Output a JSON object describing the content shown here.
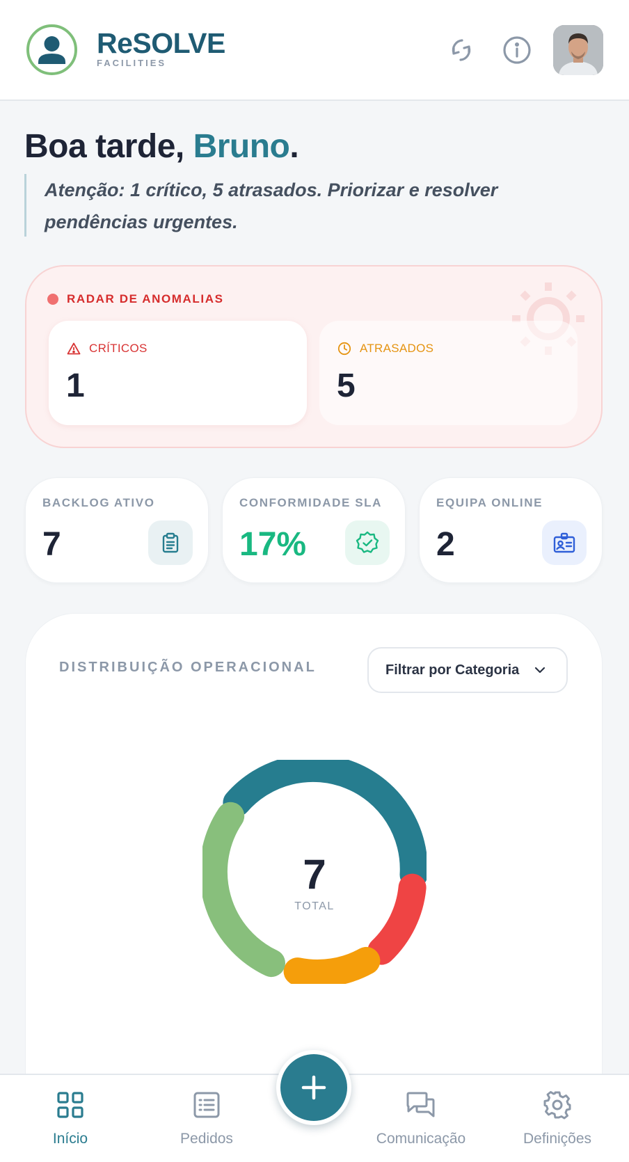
{
  "app": {
    "brand_name": "ReSOLVE",
    "brand_sub": "FACILITIES",
    "logo_icon": "user-circle-icon",
    "header_actions": [
      "sync-icon",
      "info-icon"
    ],
    "avatar_icon": "user-avatar"
  },
  "greeting": {
    "prefix": "Boa tarde, ",
    "name": "Bruno",
    "suffix": "."
  },
  "notice": "Atenção: 1 crítico, 5 atrasados. Priorizar e resolver pendências urgentes.",
  "radar": {
    "title": "RADAR DE ANOMALIAS",
    "critical_label": "CRÍTICOS",
    "critical_value": "1",
    "late_label": "ATRASADOS",
    "late_value": "5",
    "colors": {
      "critical": "#d83434",
      "late": "#e59412"
    }
  },
  "stats": [
    {
      "label": "BACKLOG ATIVO",
      "value": "7",
      "icon": "clipboard-icon"
    },
    {
      "label": "CONFORMIDADE SLA",
      "value": "17%",
      "icon": "verified-badge-icon"
    },
    {
      "label": "EQUIPA ONLINE",
      "value": "2",
      "icon": "id-badge-icon"
    }
  ],
  "distribution": {
    "title": "DISTRIBUIÇÃO OPERACIONAL",
    "filter_label": "Filtrar por Categoria",
    "total_value": "7",
    "total_label": "TOTAL",
    "segment_colors": [
      "#267d8f",
      "#ef4444",
      "#f59e0b",
      "#88bf7c"
    ]
  },
  "nav": {
    "items": [
      {
        "label": "Início",
        "icon": "grid-icon",
        "active": true
      },
      {
        "label": "Pedidos",
        "icon": "list-icon",
        "active": false
      },
      {
        "label": "Comunicação",
        "icon": "chat-icon",
        "active": false
      },
      {
        "label": "Definições",
        "icon": "gear-icon",
        "active": false
      }
    ],
    "fab_icon": "plus-icon"
  }
}
